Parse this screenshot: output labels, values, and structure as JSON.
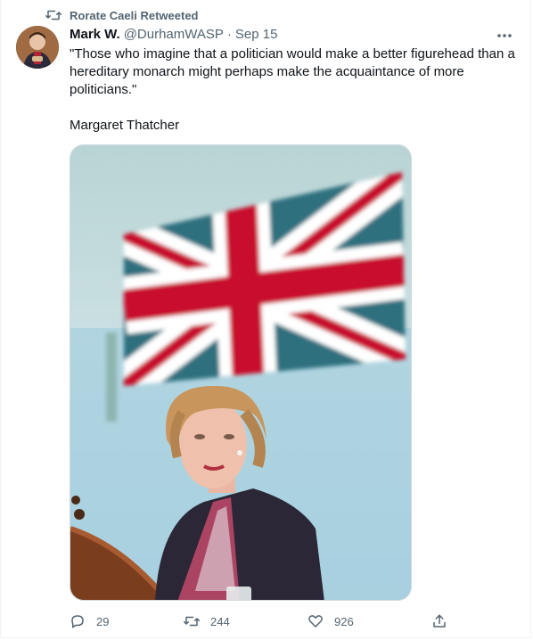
{
  "retweet": {
    "label": "Rorate Caeli Retweeted",
    "icon": "retweet-icon"
  },
  "author": {
    "name": "Mark W.",
    "handle": "@DurhamWASP",
    "separator": "·",
    "timestamp": "Sep 15",
    "avatar_icon": "user-avatar"
  },
  "more_icon": "more-horizontal-icon",
  "tweet": {
    "text": "\"Those who imagine that a politician would make a better figurehead than a hereditary monarch might perhaps make the acquaintance of more politicians.\"",
    "attribution": "Margaret Thatcher"
  },
  "media": {
    "icon": "photo-image"
  },
  "actions": {
    "reply": {
      "icon": "reply-icon",
      "count": "29"
    },
    "retweet": {
      "icon": "retweet-icon",
      "count": "244"
    },
    "like": {
      "icon": "heart-icon",
      "count": "926"
    },
    "share": {
      "icon": "share-icon"
    }
  },
  "colors": {
    "text": "#0f1419",
    "secondary": "#536471",
    "border": "#cfd9de",
    "flag_red": "#c8102e",
    "flag_blue": "#2d6b7e"
  }
}
